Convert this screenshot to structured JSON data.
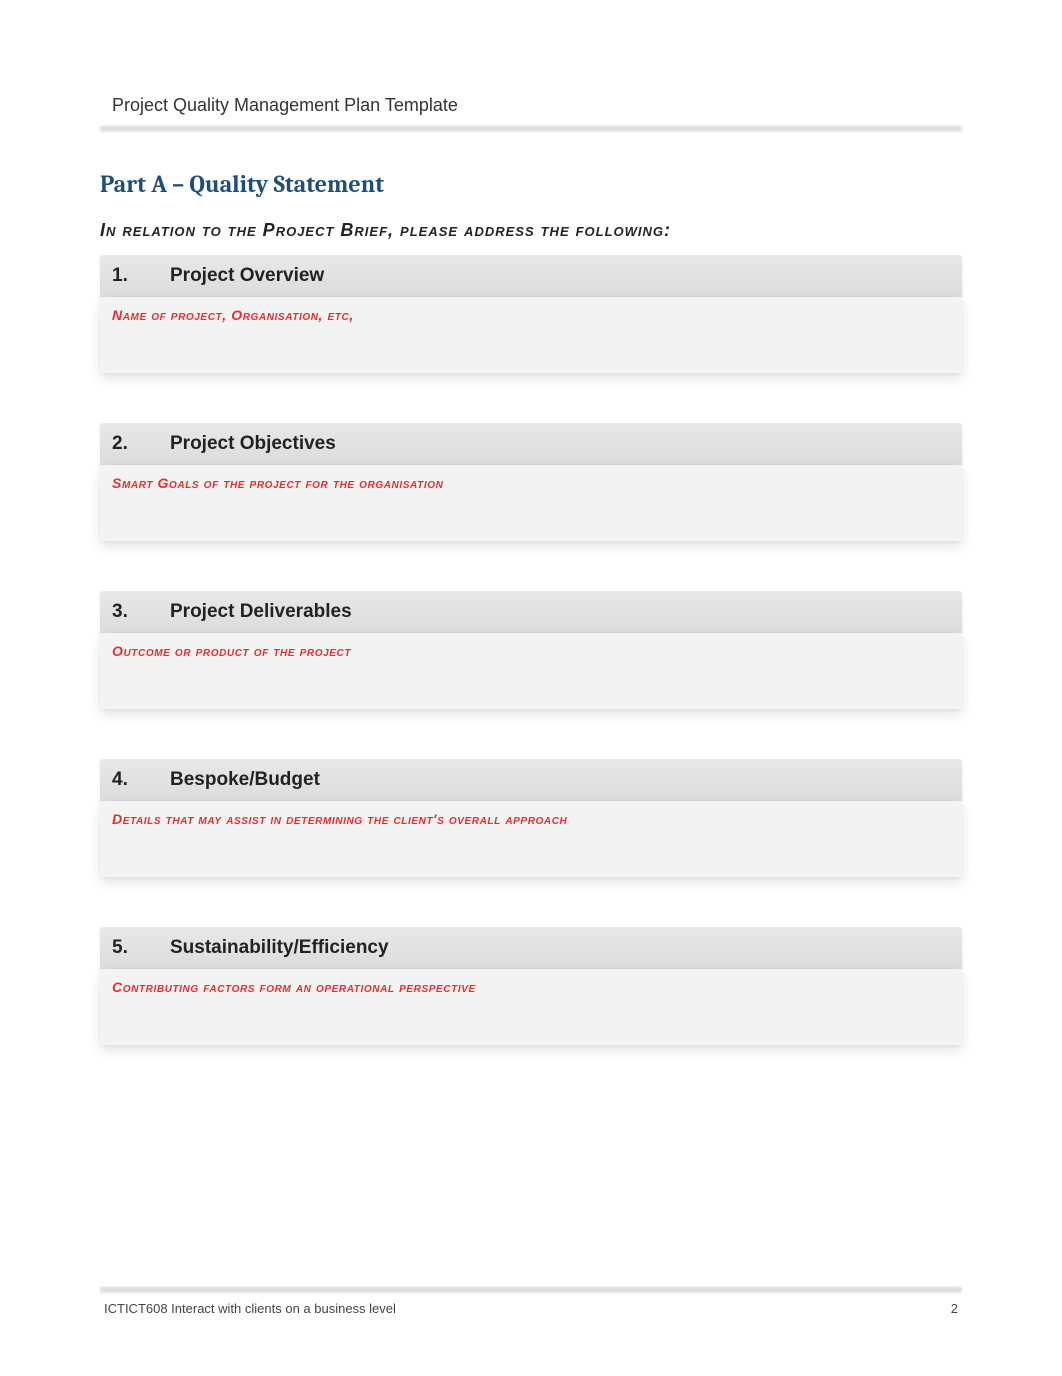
{
  "header": {
    "title": "Project Quality Management Plan Template"
  },
  "part": {
    "title": "Part A – Quality Statement",
    "intro": "In relation to the Project Brief, please address the following:"
  },
  "sections": [
    {
      "num": "1.",
      "title": "Project Overview",
      "hint": "Name of project, Organisation, etc,"
    },
    {
      "num": "2.",
      "title": "Project Objectives",
      "hint": "Smart Goals of the project for the organisation"
    },
    {
      "num": "3.",
      "title": "Project Deliverables",
      "hint": "Outcome or product of the project"
    },
    {
      "num": "4.",
      "title": "Bespoke/Budget",
      "hint": "Details that may assist in determining the client's overall approach"
    },
    {
      "num": "5.",
      "title": "Sustainability/Efficiency",
      "hint": "Contributing factors form an operational perspective"
    }
  ],
  "footer": {
    "left": "ICTICT608 Interact with clients on a business level",
    "right": "2"
  }
}
